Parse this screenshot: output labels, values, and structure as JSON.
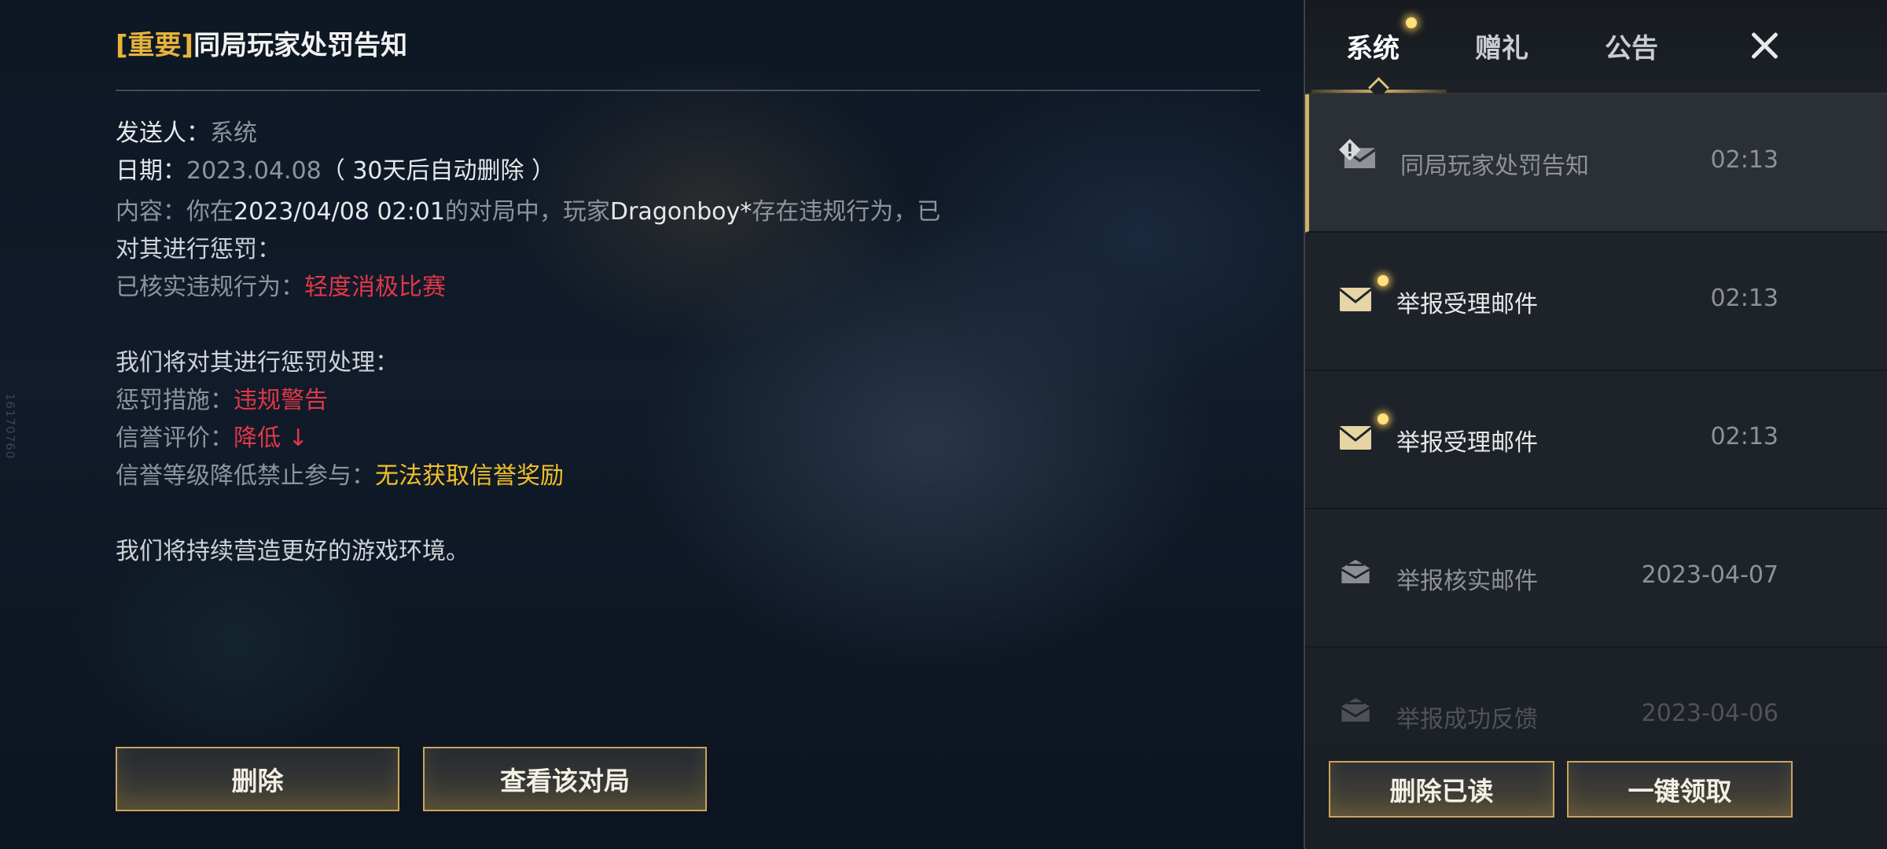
{
  "side_id": "16170760",
  "detail": {
    "title_tag": "[重要]",
    "title_text": "同局玩家处罚告知",
    "sender_label": "发送人：",
    "sender_value": "系统",
    "date_label": "日期：",
    "date_value": "2023.04.08",
    "date_note": "（ 30天后自动删除 ）",
    "content_label": "内容：",
    "content_pre": "你在",
    "content_time": "2023/04/08 02:01",
    "content_mid": "的对局中，玩家",
    "content_player": "Dragonboy*",
    "content_post": "存在违规行为，已",
    "content_line2": "对其进行惩罚：",
    "verified_label": "已核实违规行为：",
    "verified_value": "轻度消极比赛",
    "punish_intro": "我们将对其进行惩罚处理：",
    "measure_label": "惩罚措施：",
    "measure_value": "违规警告",
    "credit_label": "信誉评价：",
    "credit_value": "降低 ↓",
    "ban_label": "信誉等级降低禁止参与：",
    "ban_value": "无法获取信誉奖励",
    "closing": "我们将持续营造更好的游戏环境。",
    "delete_button": "删除",
    "view_match_button": "查看该对局"
  },
  "panel": {
    "tabs": [
      "系统",
      "赠礼",
      "公告"
    ],
    "mails": [
      {
        "subject": "同局玩家处罚告知",
        "time": "02:13",
        "icon": "mail-important-icon"
      },
      {
        "subject": "举报受理邮件",
        "time": "02:13",
        "icon": "mail-unread-icon"
      },
      {
        "subject": "举报受理邮件",
        "time": "02:13",
        "icon": "mail-unread-icon"
      },
      {
        "subject": "举报核实邮件",
        "time": "2023-04-07",
        "icon": "mail-read-icon"
      },
      {
        "subject": "举报成功反馈",
        "time": "2023-04-06",
        "icon": "mail-read-icon"
      }
    ],
    "delete_read_button": "删除已读",
    "claim_all_button": "一键领取"
  },
  "colors": {
    "accent_gold": "#e8b33c",
    "warning_red": "#e0374a",
    "reward_yellow": "#f0c028",
    "button_border": "#c9a55c"
  }
}
